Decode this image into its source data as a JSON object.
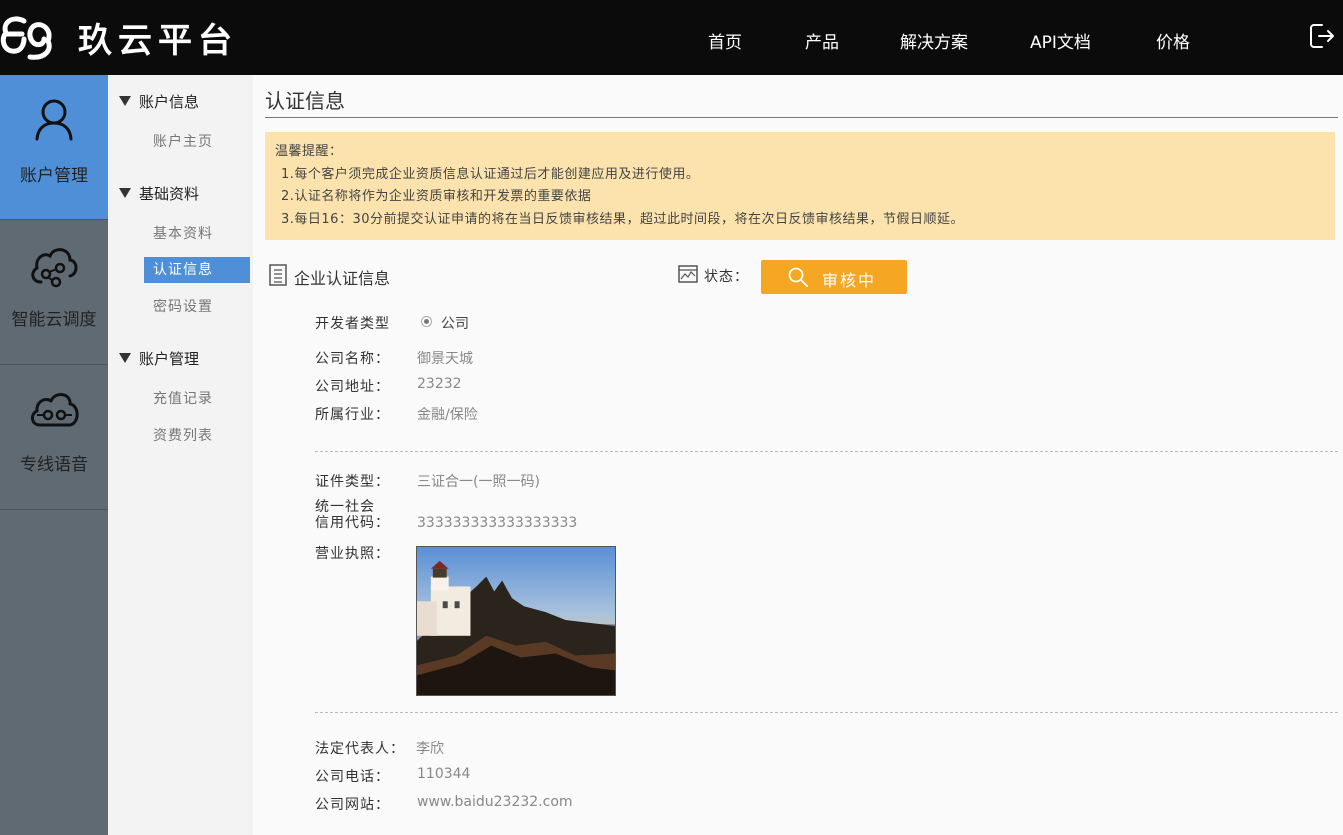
{
  "brand": {
    "name": "玖云平台"
  },
  "nav": {
    "items": [
      "首页",
      "产品",
      "解决方案",
      "API文档",
      "价格"
    ],
    "logout_icon": "logout-icon"
  },
  "iconbar": {
    "items": [
      {
        "label": "账户管理",
        "icon": "user-icon",
        "active": true
      },
      {
        "label": "智能云调度",
        "icon": "cloud-network-icon",
        "active": false
      },
      {
        "label": "专线语音",
        "icon": "cloud-voice-icon",
        "active": false
      }
    ]
  },
  "submenu": {
    "groups": [
      {
        "title": "账户信息",
        "items": [
          "账户主页"
        ]
      },
      {
        "title": "基础资料",
        "items": [
          "基本资料",
          "认证信息",
          "密码设置"
        ]
      },
      {
        "title": "账户管理",
        "items": [
          "充值记录",
          "资费列表"
        ]
      }
    ],
    "active_item": "认证信息"
  },
  "page": {
    "title": "认证信息"
  },
  "notice": {
    "heading": "温馨提醒：",
    "lines": [
      "1.每个客户须完成企业资质信息认证通过后才能创建应用及进行使用。",
      "2.认证名称将作为企业资质审核和开发票的重要依据",
      "3.每日16：30分前提交认证申请的将在当日反馈审核结果，超过此时间段，将在次日反馈审核结果，节假日顺延。"
    ]
  },
  "section": {
    "title": "企业认证信息",
    "status_label": "状态：",
    "status_value": "审核中"
  },
  "form": {
    "developer_type_label": "开发者类型",
    "developer_type_value": "公司",
    "company_name_label": "公司名称：",
    "company_name_value": "御景天城",
    "company_address_label": "公司地址：",
    "company_address_value": "23232",
    "industry_label": "所属行业：",
    "industry_value": "金融/保险",
    "cert_type_label": "证件类型：",
    "cert_type_value": "三证合一(一照一码)",
    "credit_code_label_1": "统一社会",
    "credit_code_label_2": "信用代码：",
    "credit_code_value": "333333333333333333",
    "license_label": "营业执照：",
    "legal_rep_label": "法定代表人：",
    "legal_rep_value": "李欣",
    "phone_label": "公司电话：",
    "phone_value": "110344",
    "website_label": "公司网站：",
    "website_value": "www.baidu23232.com"
  },
  "colors": {
    "topbar": "#0b0b0b",
    "accent_blue": "#4f8fd8",
    "sidebar_gray": "#5f6a73",
    "notice_bg": "#fce3ae",
    "status_orange": "#f5a623"
  }
}
